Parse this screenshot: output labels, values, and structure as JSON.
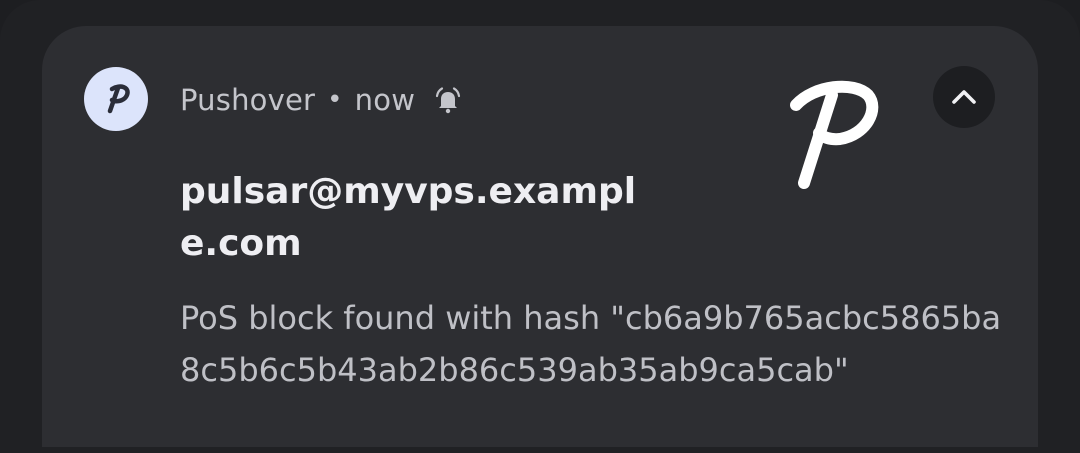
{
  "notification": {
    "app_name": "Pushover",
    "separator": "•",
    "time": "now",
    "title": "pulsar@myvps.example.com",
    "body": "PoS block found with hash \"cb6a9b765acbc5865ba8c5b6c5b43ab2b86c539ab35ab9ca5cab\"",
    "app_icon": "pushover-p-logo-icon",
    "alert_icon": "bell-ringing-icon",
    "collapse_icon": "chevron-up-icon",
    "large_icon": "pushover-p-logo-icon"
  },
  "colors": {
    "background": "#1d1e21",
    "card": "#2d2e32",
    "app_icon_bg": "#dce4fb",
    "app_icon_fg": "#2a2d39",
    "title": "#eeeef2",
    "body": "#bfc0c6",
    "header": "#c4c5cb"
  }
}
